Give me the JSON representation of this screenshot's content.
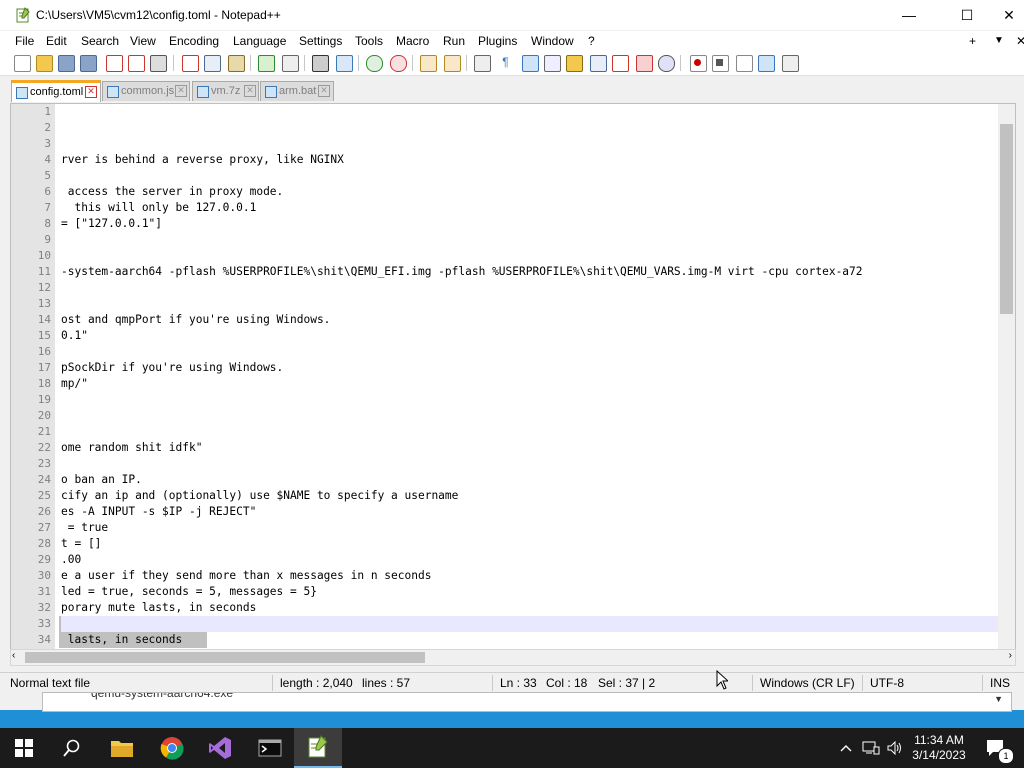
{
  "window": {
    "title": "C:\\Users\\VM5\\cvm12\\config.toml - Notepad++",
    "minimize": "—",
    "maximize": "☐",
    "close": "✕"
  },
  "menu": [
    "File",
    "Edit",
    "Search",
    "View",
    "Encoding",
    "Language",
    "Settings",
    "Tools",
    "Macro",
    "Run",
    "Plugins",
    "Window",
    "?"
  ],
  "menu_right": {
    "plus": "+",
    "down": "▼",
    "close": "✕"
  },
  "tabs": [
    {
      "label": "config.toml",
      "active": true
    },
    {
      "label": "common.js",
      "active": false
    },
    {
      "label": "vm.7z",
      "active": false
    },
    {
      "label": "arm.bat",
      "active": false
    }
  ],
  "editor": {
    "line_numbers": [
      "1",
      "2",
      "3",
      "4",
      "5",
      "6",
      "7",
      "8",
      "9",
      "10",
      "11",
      "12",
      "13",
      "14",
      "15",
      "16",
      "17",
      "18",
      "19",
      "20",
      "21",
      "22",
      "23",
      "24",
      "25",
      "26",
      "27",
      "28",
      "29",
      "30",
      "31",
      "32",
      "33",
      "34"
    ],
    "lines": [
      "",
      "",
      "",
      "rver is behind a reverse proxy, like NGINX",
      "",
      " access the server in proxy mode.",
      "  this will only be 127.0.0.1",
      "= [\"127.0.0.1\"]",
      "",
      "",
      "-system-aarch64 -pflash %USERPROFILE%\\shit\\QEMU_EFI.img -pflash %USERPROFILE%\\shit\\QEMU_VARS.img-M virt -cpu cortex-a72",
      "",
      "",
      "ost and qmpPort if you're using Windows.",
      "0.1\"",
      "",
      "pSockDir if you're using Windows.",
      "mp/\"",
      "",
      "",
      "",
      "ome random shit idfk\"",
      "",
      "o ban an IP.",
      "cify an ip and (optionally) use $NAME to specify a username",
      "es -A INPUT -s $IP -j REJECT\"",
      " = true",
      "t = []",
      ".00",
      "e a user if they send more than x messages in n seconds",
      "led = true, seconds = 5, messages = 5}",
      "porary mute lasts, in seconds",
      "",
      " lasts, in seconds"
    ]
  },
  "status": {
    "file_type": "Normal text file",
    "length": "length : 2,040",
    "lines": "lines : 57",
    "ln": "Ln : 33",
    "col": "Col : 18",
    "sel": "Sel : 37 | 2",
    "eol": "Windows (CR LF)",
    "encoding": "UTF-8",
    "mode": "INS"
  },
  "behind_text": "qemu-system-aarch64.exe",
  "clock": {
    "time": "11:34 AM",
    "date": "3/14/2023"
  },
  "notification_count": "1",
  "colors": {
    "taskbar": "#1b1b1b",
    "desktop": "#1f8fd6",
    "tab_accent": "#f5a623"
  }
}
